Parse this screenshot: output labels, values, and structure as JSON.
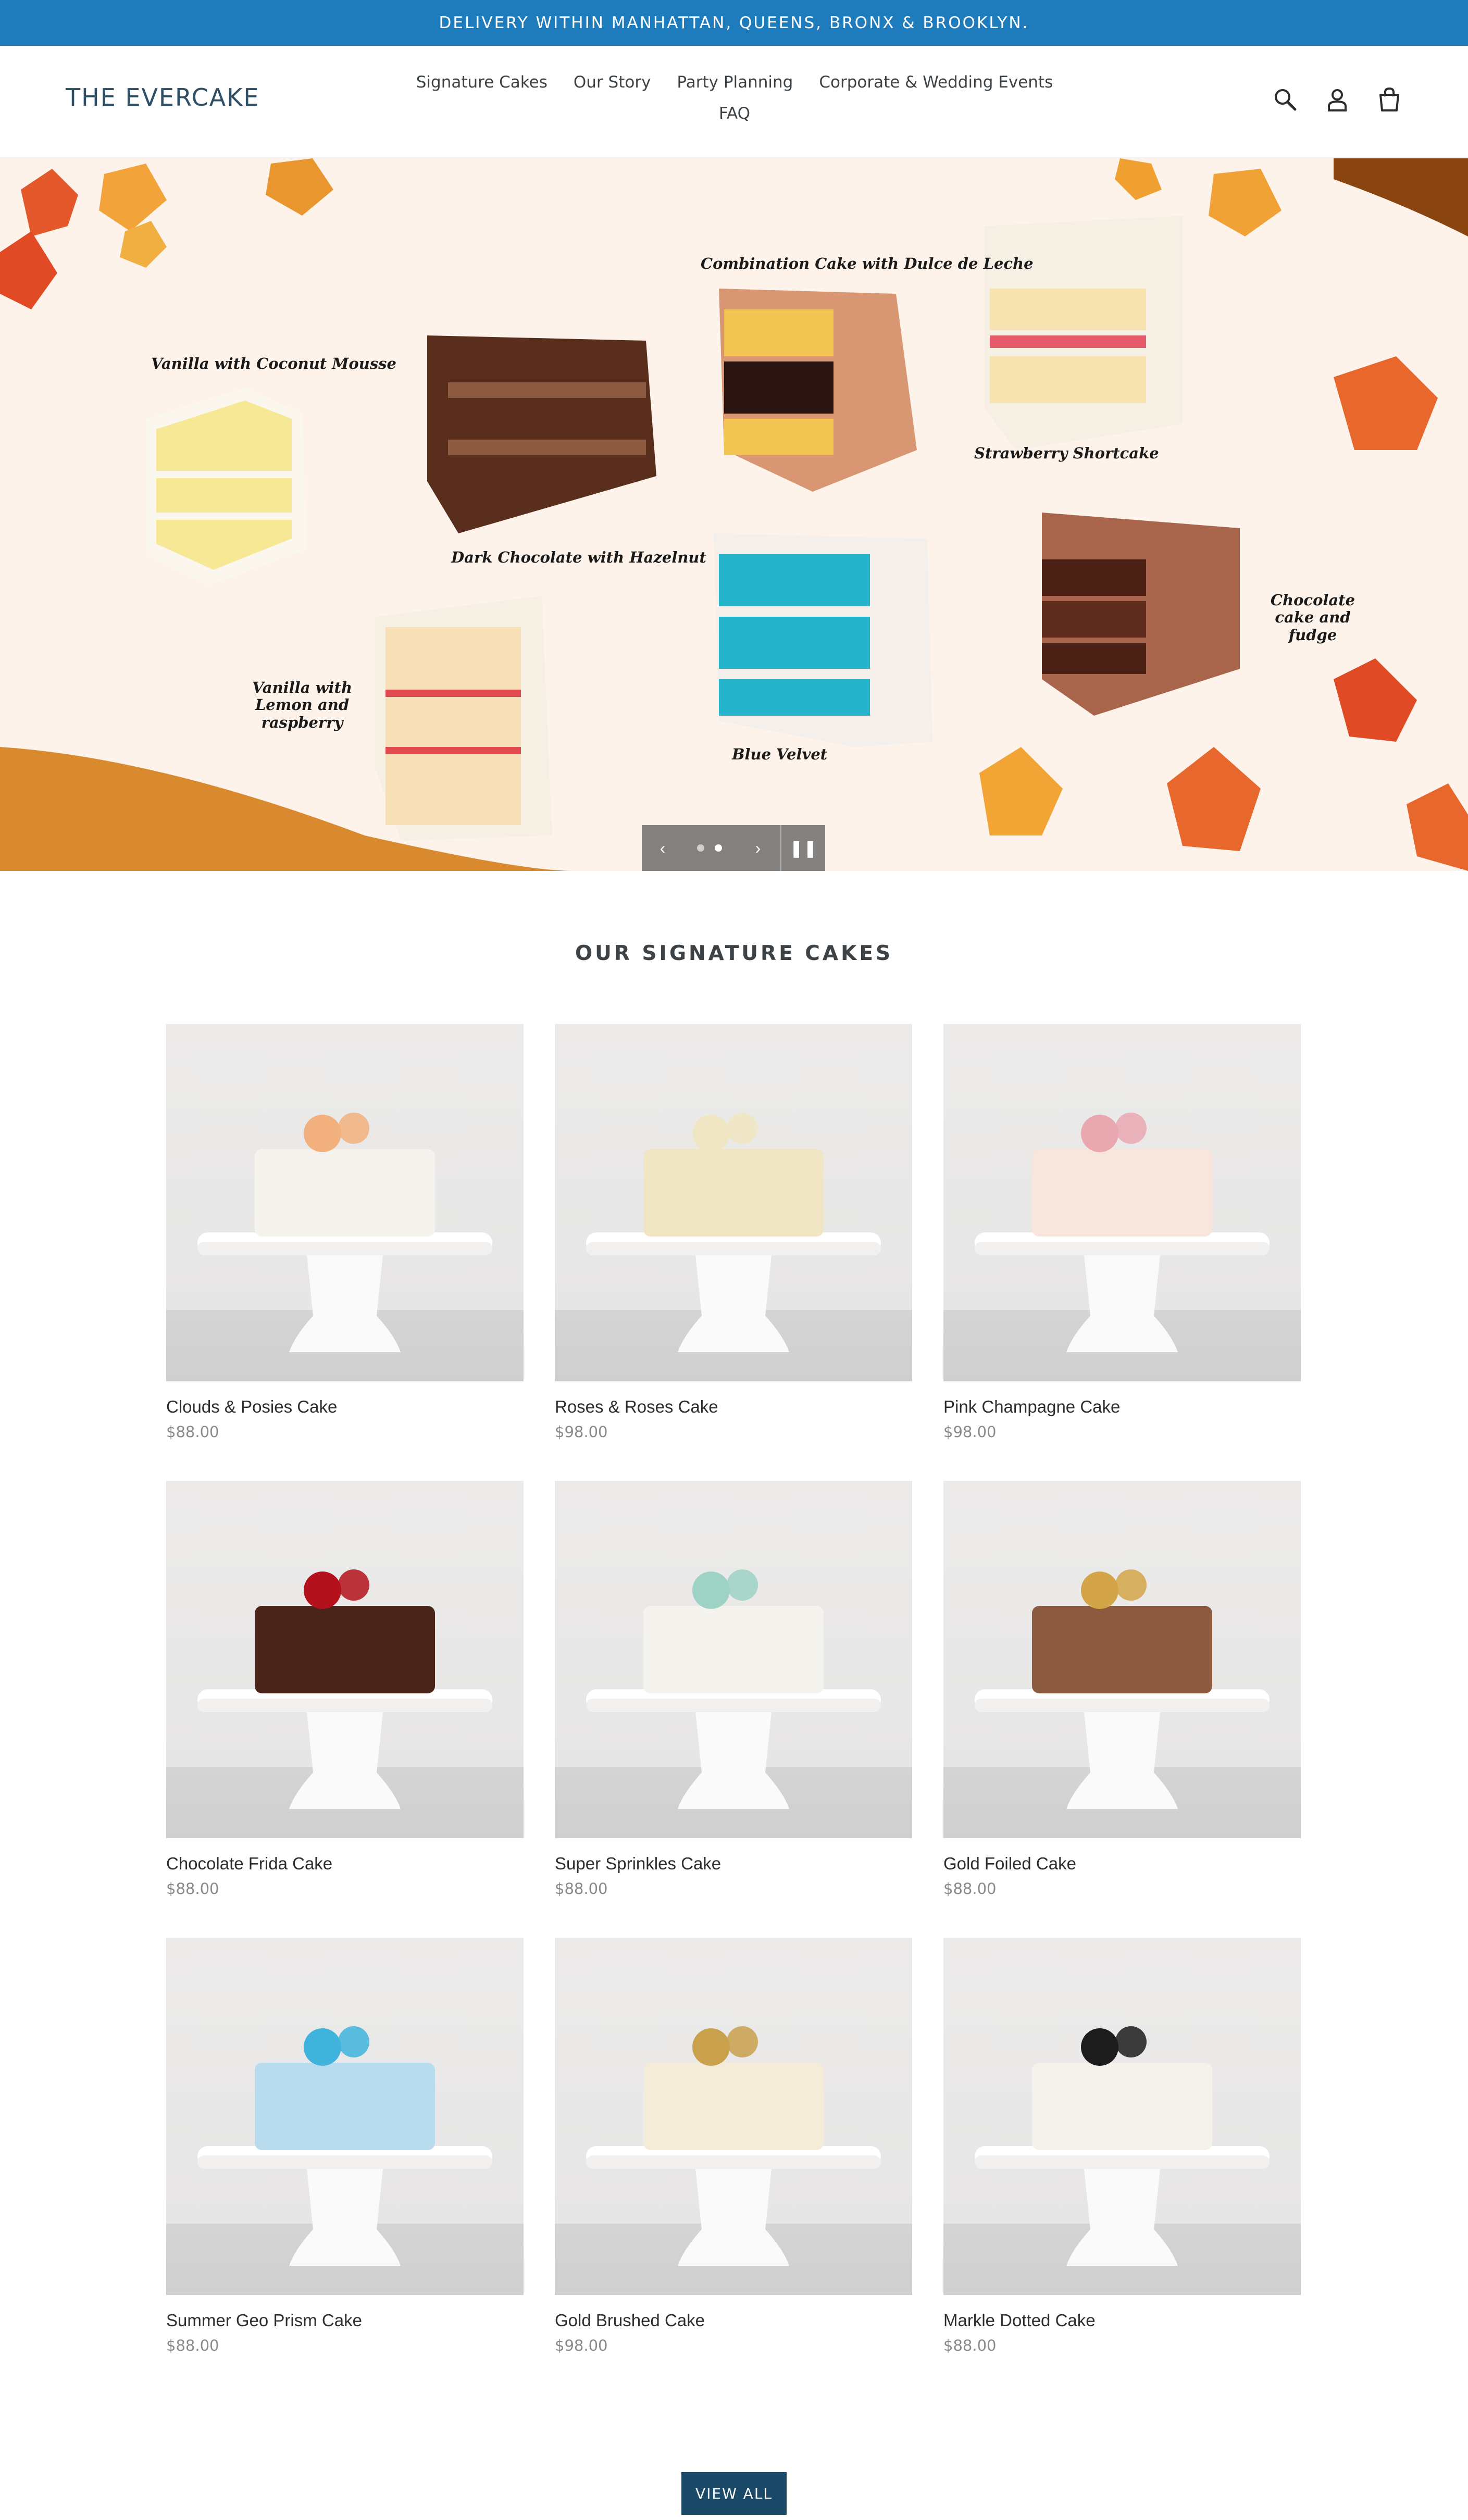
{
  "announcement": "DELIVERY WITHIN MANHATTAN, QUEENS, BRONX & BROOKLYN.",
  "header": {
    "logo": "THE EVERCAKE",
    "nav": [
      "Signature Cakes",
      "Our Story",
      "Party Planning",
      "Corporate & Wedding Events",
      "FAQ"
    ],
    "icons": [
      "search-icon",
      "account-icon",
      "cart-icon"
    ]
  },
  "hero": {
    "labels": {
      "vanilla_coconut": "Vanilla with Coconut Mousse",
      "dark_choc": "Dark Chocolate with Hazelnut",
      "combination": "Combination Cake with Dulce de Leche",
      "strawberry": "Strawberry Shortcake",
      "vanilla_lemon": "Vanilla with Lemon and raspberry",
      "blue_velvet": "Blue Velvet",
      "choc_fudge": "Chocolate cake and fudge"
    },
    "slide_count": 2,
    "active_slide": 2
  },
  "section": {
    "title": "OUR SIGNATURE CAKES",
    "products": [
      {
        "name": "Clouds & Posies Cake",
        "price": "$88.00",
        "cake": "#f6f3ee",
        "topper": "#f2b07e"
      },
      {
        "name": "Roses & Roses Cake",
        "price": "$98.00",
        "cake": "#f1e6c3",
        "topper": "#f1e6c3"
      },
      {
        "name": "Pink Champagne Cake",
        "price": "$98.00",
        "cake": "#f8e6dd",
        "topper": "#e9a7b0"
      },
      {
        "name": "Chocolate Frida Cake",
        "price": "$88.00",
        "cake": "#4a2419",
        "topper": "#b3121c"
      },
      {
        "name": "Super Sprinkles Cake",
        "price": "$88.00",
        "cake": "#f5f3ee",
        "topper": "#9ed2c4"
      },
      {
        "name": "Gold Foiled Cake",
        "price": "$88.00",
        "cake": "#8b5a3f",
        "topper": "#d4a548"
      },
      {
        "name": "Summer Geo Prism Cake",
        "price": "$88.00",
        "cake": "#b8dcee",
        "topper": "#3fb3dc"
      },
      {
        "name": "Gold Brushed Cake",
        "price": "$98.00",
        "cake": "#f4ecd8",
        "topper": "#c9a04c"
      },
      {
        "name": "Markle Dotted Cake",
        "price": "$88.00",
        "cake": "#f5f2ec",
        "topper": "#1c1c1c"
      }
    ]
  },
  "view_all": "VIEW ALL",
  "colors": {
    "announce_bg": "#1e7bbc",
    "button_bg": "#1a4a67",
    "hero_bg": "#fdf3ea"
  }
}
